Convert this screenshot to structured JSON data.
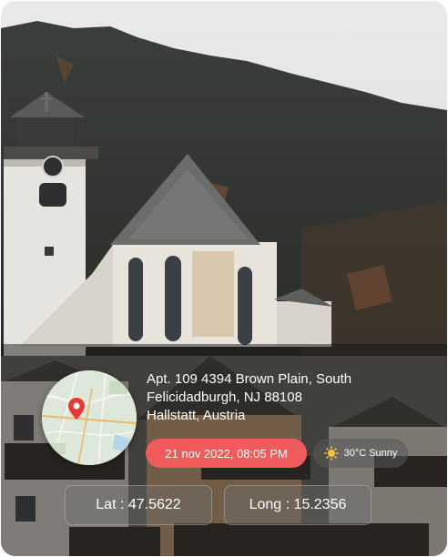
{
  "location": {
    "address_line1": "Apt. 109 4394 Brown Plain, South",
    "address_line2": "Felicidadburgh, NJ 88108",
    "address_line3": "Hallstatt, Austria"
  },
  "datetime": "21 nov 2022, 08:05 PM",
  "weather": {
    "label": "30°C Sunny",
    "icon": "sun-icon"
  },
  "coordinates": {
    "lat_label": "Lat : 47.5622",
    "long_label": "Long : 15.2356"
  },
  "colors": {
    "accent": "#f05b5b",
    "pin": "#e53935"
  },
  "icons": {
    "map_pin": "map-pin-icon"
  }
}
